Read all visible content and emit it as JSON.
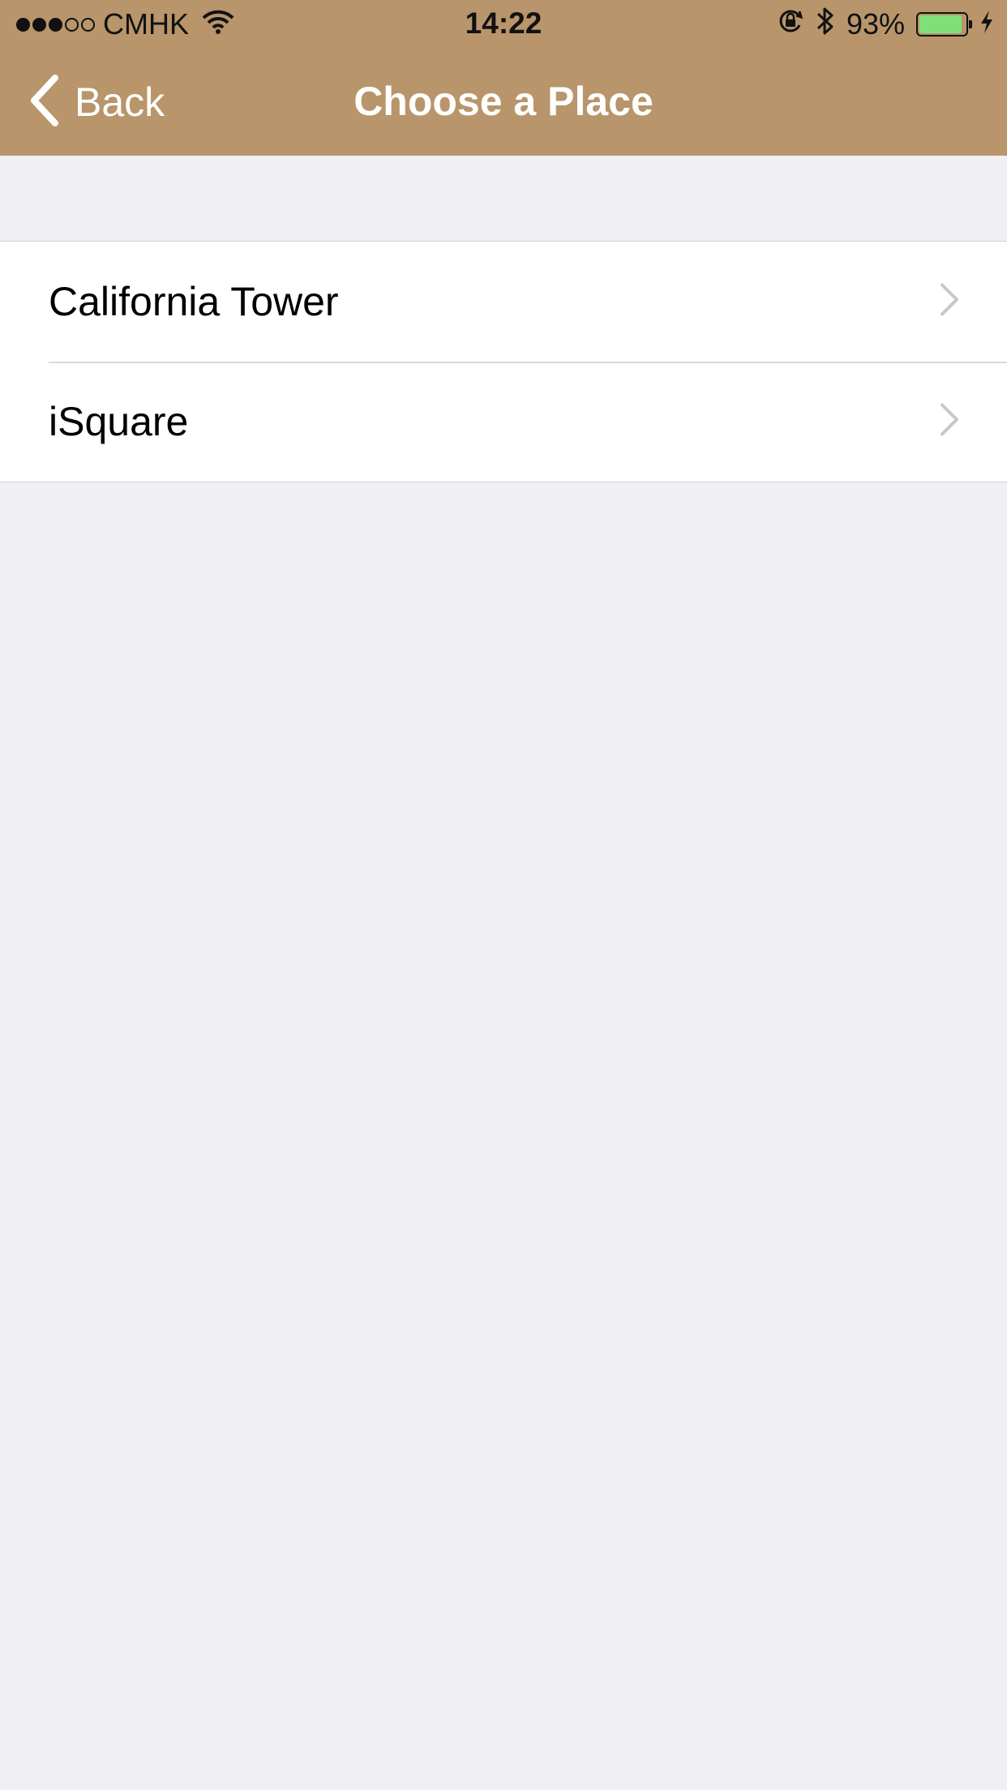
{
  "status_bar": {
    "signal_strength": "3 of 5",
    "carrier": "CMHK",
    "wifi_icon": "wifi-icon",
    "time": "14:22",
    "orientation_lock_icon": "orientation-lock-icon",
    "bluetooth_icon": "bluetooth-icon",
    "battery_percent": "93%",
    "battery_level": 0.93,
    "charging_icon": "charging-bolt-icon"
  },
  "nav": {
    "back_icon": "chevron-left-icon",
    "back_label": "Back",
    "title": "Choose a Place"
  },
  "places": {
    "items": [
      {
        "label": "California Tower",
        "icon": "chevron-right-icon"
      },
      {
        "label": "iSquare",
        "icon": "chevron-right-icon"
      }
    ]
  },
  "colors": {
    "nav_bar": "#b8956a",
    "background": "#efeff4",
    "battery_fill": "#7fe07a",
    "chevron": "#c7c7cc"
  }
}
